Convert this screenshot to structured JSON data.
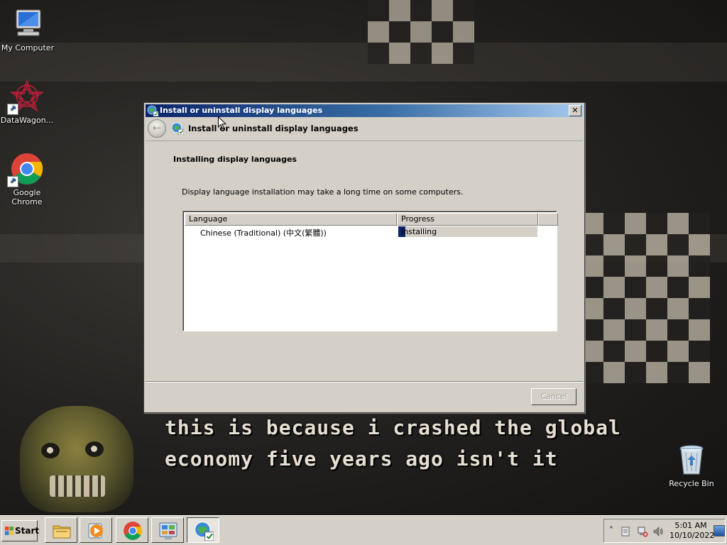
{
  "desktop": {
    "icons": [
      {
        "label": "My Computer",
        "icon": "computer-icon"
      },
      {
        "label": "DataWagon...",
        "icon": "datawagon-icon"
      },
      {
        "label": "Google Chrome",
        "icon": "chrome-icon"
      },
      {
        "label": "Recycle Bin",
        "icon": "recycle-bin-icon"
      }
    ],
    "wallpaper_caption": {
      "line1": "this is because i crashed the global",
      "line2": "economy five years ago isn't it"
    }
  },
  "dialog": {
    "window_title": "Install or uninstall display languages",
    "nav_title": "Install or uninstall display languages",
    "heading": "Installing display languages",
    "description": "Display language installation may take a long time on some computers.",
    "table": {
      "columns": [
        "Language",
        "Progress"
      ],
      "rows": [
        {
          "language": "Chinese (Traditional) (中文(繁體))",
          "status": "Installing",
          "progress_percent": 5
        }
      ]
    },
    "cancel_label": "Cancel",
    "close_glyph": "✕",
    "back_glyph": "←"
  },
  "taskbar": {
    "start_label": "Start",
    "apps": [
      {
        "name": "file-explorer",
        "icon": "folder-icon"
      },
      {
        "name": "media-player",
        "icon": "media-player-icon"
      },
      {
        "name": "google-chrome",
        "icon": "chrome-icon"
      },
      {
        "name": "control-panel",
        "icon": "control-panel-icon"
      },
      {
        "name": "language-installer",
        "icon": "language-installer-icon",
        "active": true
      }
    ],
    "tray": {
      "chevron": "˄",
      "clock_time": "5:01 AM",
      "clock_date": "10/10/2022"
    }
  },
  "colors": {
    "titlebar_start": "#0a246a",
    "titlebar_end": "#a6caf0",
    "window_face": "#d4d0c8",
    "progress_fill": "#0a246a"
  }
}
